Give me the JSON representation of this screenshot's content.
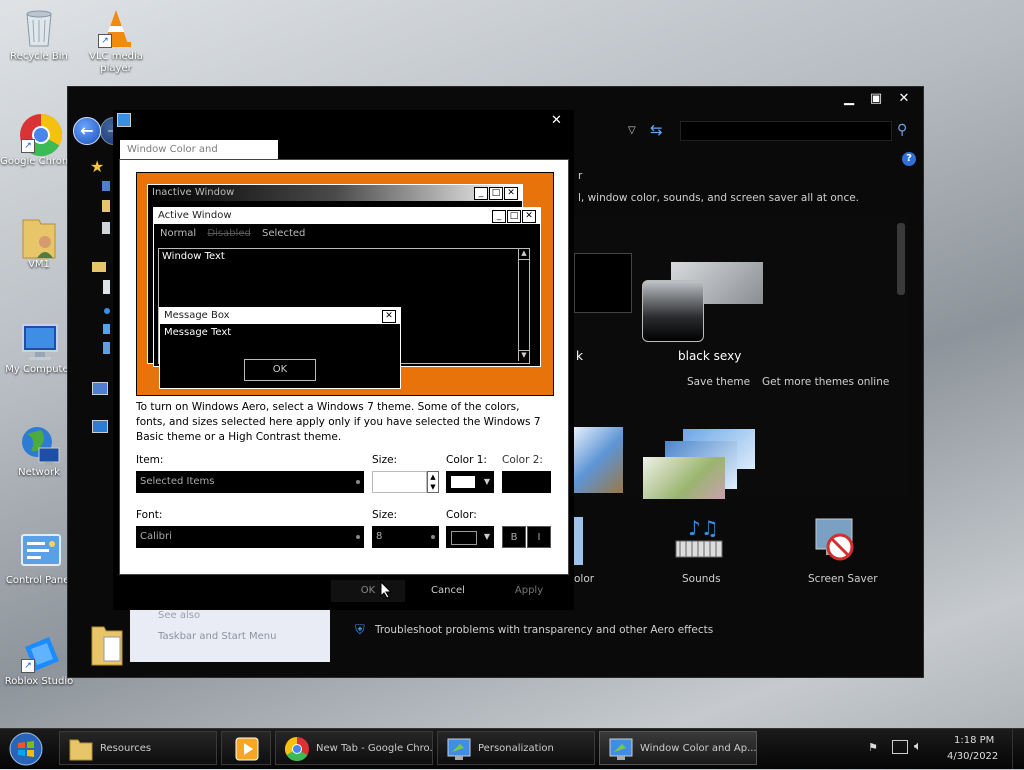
{
  "desktop": {
    "icons": [
      {
        "label": "Recycle Bin"
      },
      {
        "label": "VLC media player"
      },
      {
        "label": "Google Chrome"
      },
      {
        "label": "VM1"
      },
      {
        "label": "My Computer"
      },
      {
        "label": "Network"
      },
      {
        "label": "Control Panel"
      },
      {
        "label": "Roblox Studio"
      }
    ]
  },
  "personalization": {
    "intro_text": "l, window color, sounds, and screen saver all at once.",
    "theme_left_label": "k",
    "theme_label": "black sexy",
    "save_theme": "Save theme",
    "get_more": "Get more themes online",
    "bottom_items": [
      {
        "label": "olor"
      },
      {
        "label": "Sounds"
      },
      {
        "label": "Screen Saver"
      }
    ],
    "see_also": "See also",
    "see_also_link": "Taskbar and Start Menu",
    "troubleshoot": "Troubleshoot problems with transparency and other Aero effects"
  },
  "dialog": {
    "tab_title": "Window Color and Appearance",
    "preview": {
      "inactive_title": "Inactive Window",
      "active_title": "Active Window",
      "menu_normal": "Normal",
      "menu_disabled": "Disabled",
      "menu_selected": "Selected",
      "window_text": "Window Text",
      "msg_title": "Message Box",
      "msg_text": "Message Text",
      "msg_ok": "OK"
    },
    "info_text": "To turn on Windows Aero, select a Windows 7 theme.  Some of the colors, fonts, and sizes selected here apply only if you have selected the Windows 7 Basic theme or a High Contrast theme.",
    "item_label": "Item:",
    "item_value": "Selected Items",
    "size_label": "Size:",
    "color1_label": "Color 1:",
    "color2_label": "Color 2:",
    "font_label": "Font:",
    "font_value": "Calibri",
    "font_size_label": "Size:",
    "font_size_value": "8",
    "color_label": "Color:",
    "bold_label": "B",
    "italic_label": "I",
    "ok": "OK",
    "cancel": "Cancel",
    "apply": "Apply"
  },
  "taskbar": {
    "buttons": [
      {
        "label": "Resources"
      },
      {
        "label": ""
      },
      {
        "label": "New Tab - Google Chro..."
      },
      {
        "label": "Personalization"
      },
      {
        "label": "Window Color and Ap..."
      }
    ],
    "time": "1:18 PM",
    "date": "4/30/2022"
  },
  "colors": {
    "preview_bg": "#e8730b",
    "dialog_bg": "#ffffff",
    "window_bg": "#0a0a0a"
  }
}
